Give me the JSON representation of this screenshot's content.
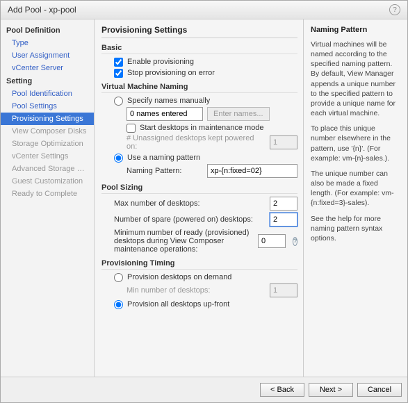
{
  "window": {
    "title": "Add Pool - xp-pool"
  },
  "sidebar": {
    "groups": [
      {
        "label": "Pool Definition",
        "items": [
          {
            "label": "Type",
            "state": "link"
          },
          {
            "label": "User Assignment",
            "state": "link"
          },
          {
            "label": "vCenter Server",
            "state": "link"
          }
        ]
      },
      {
        "label": "Setting",
        "items": [
          {
            "label": "Pool Identification",
            "state": "link"
          },
          {
            "label": "Pool Settings",
            "state": "link"
          },
          {
            "label": "Provisioning Settings",
            "state": "selected"
          },
          {
            "label": "View Composer Disks",
            "state": "disabled"
          },
          {
            "label": "Storage Optimization",
            "state": "disabled"
          },
          {
            "label": "vCenter Settings",
            "state": "disabled"
          },
          {
            "label": "Advanced Storage Options",
            "state": "disabled"
          },
          {
            "label": "Guest Customization",
            "state": "disabled"
          },
          {
            "label": "Ready to Complete",
            "state": "disabled"
          }
        ]
      }
    ]
  },
  "page": {
    "heading": "Provisioning Settings",
    "basic": {
      "title": "Basic",
      "enable_label": "Enable provisioning",
      "enable_checked": true,
      "stop_label": "Stop provisioning on error",
      "stop_checked": true
    },
    "naming": {
      "title": "Virtual Machine Naming",
      "manual_label": "Specify names manually",
      "names_entered_value": "0 names entered",
      "enter_names_btn": "Enter names...",
      "maint_label": "Start desktops in maintenance mode",
      "unassigned_label": "# Unassigned desktops kept powered on:",
      "unassigned_value": "1",
      "pattern_label": "Use a naming pattern",
      "pattern_name_label": "Naming Pattern:",
      "pattern_value": "xp-{n:fixed=02}"
    },
    "sizing": {
      "title": "Pool Sizing",
      "max_label": "Max number of desktops:",
      "max_value": "2",
      "spare_label": "Number of spare (powered on) desktops:",
      "spare_value": "2",
      "min_label": "Minimum number of ready (provisioned) desktops during View Composer maintenance operations:",
      "min_value": "0"
    },
    "timing": {
      "title": "Provisioning Timing",
      "demand_label": "Provision desktops on demand",
      "min_demand_label": "Min number of desktops:",
      "min_demand_value": "1",
      "upfront_label": "Provision all desktops up-front"
    }
  },
  "help": {
    "title": "Naming Pattern",
    "p1": "Virtual machines will be named according to the specified naming pattern. By default, View Manager appends a unique number to the specified pattern to provide a unique name for each virtual machine.",
    "p2": "To place this unique number elsewhere in the pattern, use '{n}'. (For example: vm-{n}-sales.).",
    "p3": "The unique number can also be made a fixed length. (For example: vm-{n:fixed=3}-sales).",
    "p4": "See the help for more naming pattern syntax options."
  },
  "footer": {
    "back": "< Back",
    "next": "Next >",
    "cancel": "Cancel"
  }
}
